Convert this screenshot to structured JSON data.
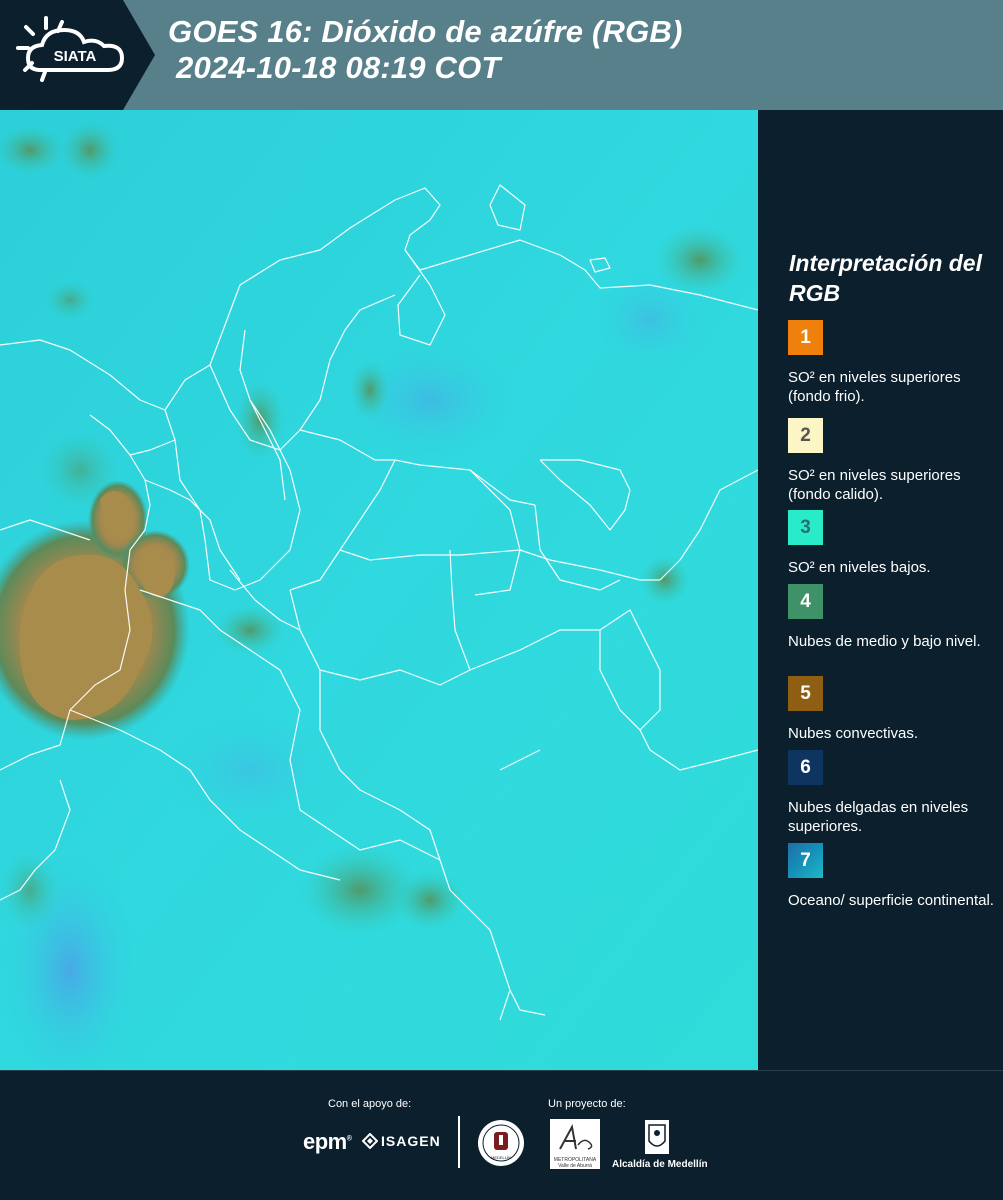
{
  "header": {
    "logo_text": "SIATA",
    "title_line1": "GOES 16: Dióxido de azúfre (RGB)",
    "title_line2": "2024-10-18 08:19 COT"
  },
  "legend": {
    "title": "Interpretación del RGB",
    "items": [
      {
        "number": "1",
        "color": "#f0800c",
        "text_color": "#ffffff",
        "label": "SO² en niveles superiores (fondo frio)."
      },
      {
        "number": "2",
        "color": "#fcf5c6",
        "text_color": "#555555",
        "label": "SO² en niveles superiores (fondo calido)."
      },
      {
        "number": "3",
        "color": "#27ebc9",
        "text_color": "#2b6f6f",
        "label": "SO² en niveles bajos."
      },
      {
        "number": "4",
        "color": "#3f9168",
        "text_color": "#ffffff",
        "label": "Nubes de medio y bajo nivel."
      },
      {
        "number": "5",
        "color": "#8e5e12",
        "text_color": "#ffffff",
        "label": "Nubes convectivas."
      },
      {
        "number": "6",
        "color": "#0e3460",
        "text_color": "#ffffff",
        "label": "Nubes delgadas en niveles superiores."
      },
      {
        "number": "7",
        "color": "#1591b8",
        "text_color": "#ffffff",
        "label": "Oceano/ superficie continental."
      }
    ]
  },
  "footer": {
    "support_label": "Con el apoyo de:",
    "project_label": "Un proyecto de:",
    "epm": "epm",
    "isagen": "ISAGEN",
    "area_logo_text": "METROPOLITANA Valle de Aburrá",
    "alcaldia": "Alcaldía de Medellín"
  },
  "colors": {
    "header_bg": "#58808b",
    "logo_bg": "#0b1f2d",
    "panel_bg": "#0b1f2d",
    "map_cyan": "#29d6de",
    "convective": "#a8894a"
  }
}
